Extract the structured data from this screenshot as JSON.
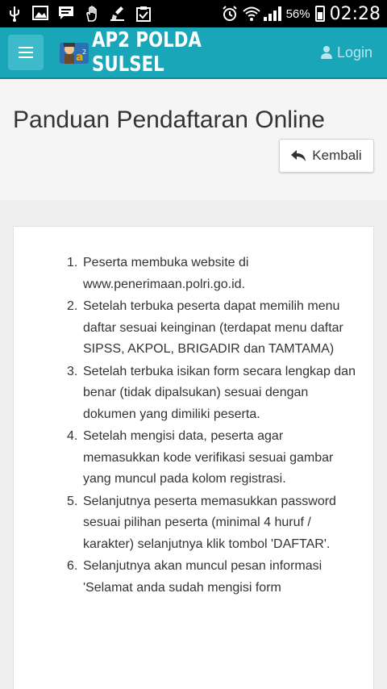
{
  "statusbar": {
    "icons": [
      "usb-icon",
      "image-icon",
      "chat-icon",
      "hand-icon",
      "cleaner-icon",
      "clipboard-check-icon"
    ],
    "battery_percent": "56%",
    "time": "02:28"
  },
  "appbar": {
    "brand": "AP2 POLDA SULSEL",
    "login_label": "Login",
    "color": "#18a6b8"
  },
  "page": {
    "title": "Panduan Pendaftaran Online",
    "back_label": "Kembali"
  },
  "steps": [
    {
      "num": "1.",
      "text": "Peserta membuka website di www.penerimaan.polri.go.id."
    },
    {
      "num": "2.",
      "text": "Setelah terbuka peserta dapat memilih menu daftar sesuai keinginan (terdapat menu daftar SIPSS, AKPOL, BRIGADIR dan TAMTAMA)"
    },
    {
      "num": "3.",
      "text": "Setelah terbuka isikan form secara lengkap dan benar (tidak dipalsukan) sesuai dengan dokumen yang dimiliki peserta."
    },
    {
      "num": "4.",
      "text": "Setelah mengisi data, peserta agar memasukkan kode verifikasi sesuai gambar yang muncul pada kolom registrasi."
    },
    {
      "num": "5.",
      "text": "Selanjutnya peserta memasukkan password sesuai pilihan peserta (minimal 4 huruf / karakter) selanjutnya klik tombol 'DAFTAR'."
    },
    {
      "num": "6.",
      "text": "Selanjutnya akan muncul pesan informasi 'Selamat anda sudah mengisi form"
    }
  ]
}
